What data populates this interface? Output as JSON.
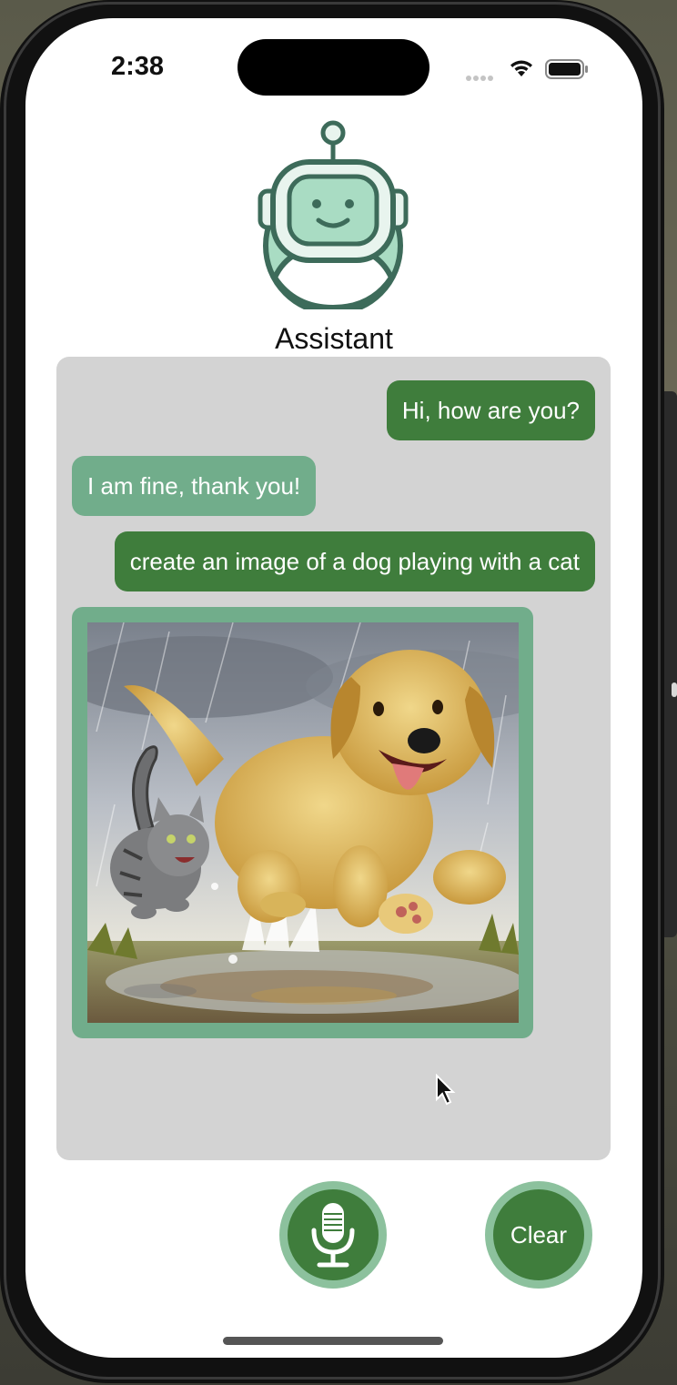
{
  "status_bar": {
    "time": "2:38"
  },
  "header": {
    "assistant_name": "Assistant"
  },
  "chat": {
    "messages": [
      {
        "role": "user",
        "text": "Hi, how are you?"
      },
      {
        "role": "assistant",
        "text": "I am fine, thank you!"
      },
      {
        "role": "user",
        "text": "create an image of a dog playing with a cat"
      }
    ]
  },
  "controls": {
    "clear_label": "Clear"
  },
  "colors": {
    "user_bubble": "#3f7d3c",
    "assistant_bubble": "#71ad8b",
    "chat_background": "#d3d3d3",
    "button_ring": "#8cc19d"
  },
  "icons": [
    "robot-avatar-icon",
    "signal-icon",
    "wifi-icon",
    "battery-icon",
    "microphone-icon",
    "cursor-icon"
  ]
}
